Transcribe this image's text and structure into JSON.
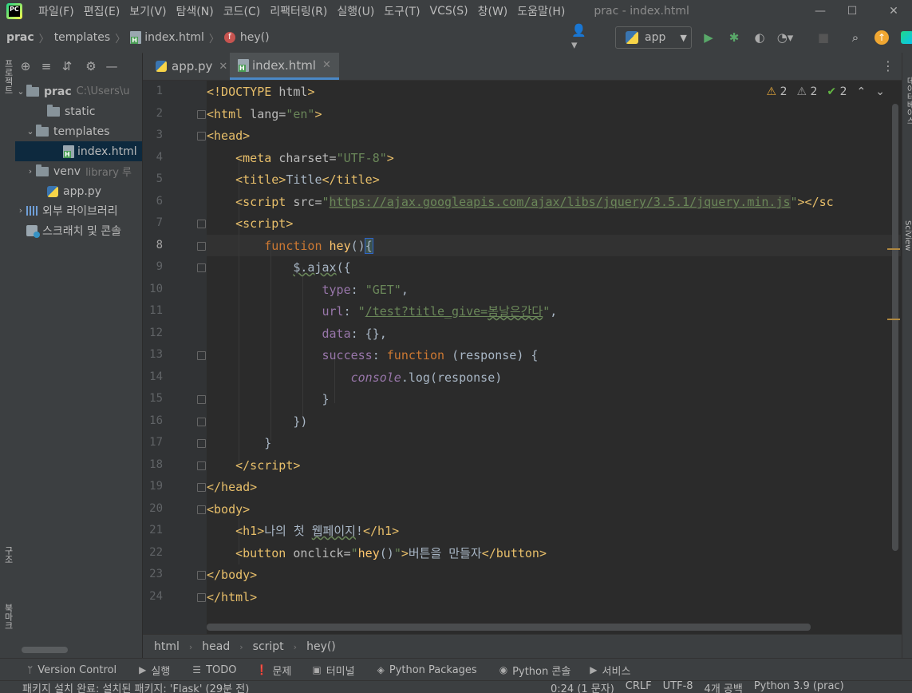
{
  "window": {
    "title": "prac - index.html",
    "menu": [
      "파일(F)",
      "편집(E)",
      "보기(V)",
      "탐색(N)",
      "코드(C)",
      "리팩터링(R)",
      "실행(U)",
      "도구(T)",
      "VCS(S)",
      "창(W)",
      "도움말(H)"
    ]
  },
  "navbar": {
    "crumbs": [
      "prac",
      "templates",
      "index.html",
      "hey()"
    ],
    "run_config": "app"
  },
  "left_strip": {
    "top_label": "프로젝트",
    "mid_label": "구조",
    "bottom_label": "북마크"
  },
  "project": {
    "root_name": "prac",
    "root_path": "C:\\Users\\u",
    "items": {
      "static": "static",
      "templates": "templates",
      "index": "index.html",
      "venv": "venv",
      "venv_note": "library 루",
      "app": "app.py",
      "external": "외부 라이브러리",
      "scratch": "스크래치 및 콘솔"
    }
  },
  "tabs": [
    "app.py",
    "index.html"
  ],
  "inspections": {
    "warnings": "2",
    "weak_warnings": "2",
    "typos": "2"
  },
  "editor": {
    "lines": [
      "1",
      "2",
      "3",
      "4",
      "5",
      "6",
      "7",
      "8",
      "9",
      "10",
      "11",
      "12",
      "13",
      "14",
      "15",
      "16",
      "17",
      "18",
      "19",
      "20",
      "21",
      "22",
      "23",
      "24"
    ],
    "current_line": 8
  },
  "right_strip": {
    "db_label": "데이터베이스",
    "sciview_label": "SciView"
  },
  "code_breadcrumbs": [
    "html",
    "head",
    "script",
    "hey()"
  ],
  "tool_windows": [
    "Version Control",
    "실행",
    "TODO",
    "문제",
    "터미널",
    "Python Packages",
    "Python 콘솔",
    "서비스"
  ],
  "status": {
    "message": "패키지 설치 완료: 설치된 패키지: 'Flask' (29분 전)",
    "position": "0:24 (1 문자)",
    "line_sep": "CRLF",
    "encoding": "UTF-8",
    "indent": "4개 공백",
    "interpreter": "Python 3.9 (prac)"
  }
}
